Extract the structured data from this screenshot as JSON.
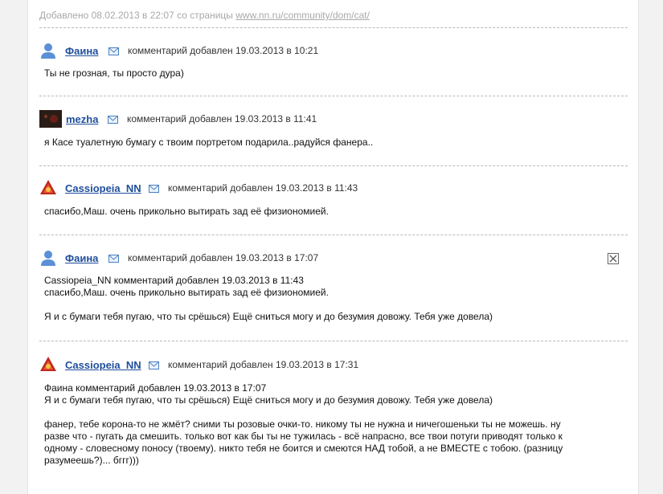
{
  "header": {
    "added_prefix": "Добавлено 08.02.2013 в 22:07 со страницы",
    "source_link": "www.nn.ru/community/dom/cat/"
  },
  "comments": [
    {
      "author": "Фаина",
      "meta": "комментарий добавлен 19.03.2013 в 10:21",
      "text": "Ты не грозная, ты просто дура)"
    },
    {
      "author": "mezha",
      "meta": "комментарий добавлен 19.03.2013 в 11:41",
      "text": "я Касе туалетную бумагу с твоим портретом подарила..радуйся фанера.."
    },
    {
      "author": "Cassiopeia_NN",
      "meta": "комментарий добавлен 19.03.2013 в 11:43",
      "text": "спасибо,Маш. очень прикольно вытирать зад её физиономией."
    },
    {
      "author": "Фаина",
      "meta": "комментарий добавлен 19.03.2013 в 17:07",
      "text": "Cassiopeia_NN комментарий добавлен 19.03.2013 в 11:43\nспасибо,Маш. очень прикольно вытирать зад её физиономией.\n\nЯ и с бумаги тебя пугаю, что ты срёшься) Ещё сниться могу и до безумия довожу. Тебя уже довела)"
    },
    {
      "author": "Cassiopeia_NN",
      "meta": "комментарий добавлен 19.03.2013 в 17:31",
      "text": "Фаина комментарий добавлен 19.03.2013 в 17:07\nЯ и с бумаги тебя пугаю, что ты срёшься) Ещё сниться могу и до безумия довожу. Тебя уже довела)\n\nфанер, тебе корона-то не жмёт? сними ты розовые очки-то. никому ты не нужна и ничегошеньки ты не можешь. ну\nразве что - пугать да смешить. только вот как бы ты не тужилась - всё напрасно, все твои потуги приводят только к\nодному - словесному поносу (твоему). никто тебя не боится и смеются НАД тобой, а не ВМЕСТЕ с тобою. (разницу\nразумеешь?)... бггг)))"
    }
  ]
}
